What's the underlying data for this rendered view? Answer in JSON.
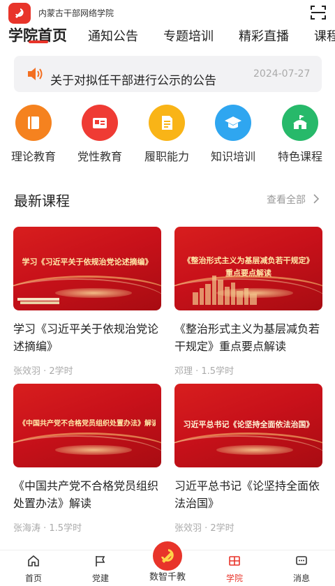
{
  "app": {
    "title": "内蒙古干部网络学院"
  },
  "tabs": [
    "学院首页",
    "通知公告",
    "专题培训",
    "精彩直播",
    "课程"
  ],
  "notice": {
    "text": "关于对拟任干部进行公示的公告",
    "date": "2024-07-27"
  },
  "categories": [
    {
      "label": "理论教育",
      "icon": "book-icon",
      "color": "#f5821f"
    },
    {
      "label": "党性教育",
      "icon": "id-card-icon",
      "color": "#ef3b34"
    },
    {
      "label": "履职能力",
      "icon": "document-icon",
      "color": "#f9b417"
    },
    {
      "label": "知识培训",
      "icon": "graduation-cap-icon",
      "color": "#2fa6f0"
    },
    {
      "label": "特色课程",
      "icon": "yurt-icon",
      "color": "#27b96a"
    }
  ],
  "latest": {
    "title": "最新课程",
    "more": "查看全部"
  },
  "courses": [
    {
      "thumb_text": "学习《习近平关于依规治党论述摘编》",
      "thumb_sub": "",
      "title": "学习《习近平关于依规治党论述摘编》",
      "meta": "张效羽 · 2学时"
    },
    {
      "thumb_text": "《整治形式主义为基层减负若干规定》",
      "thumb_sub": "重点要点解读",
      "title": "《整治形式主义为基层减负若干规定》重点要点解读",
      "meta": "邓理 · 1.5学时"
    },
    {
      "thumb_text": "《中国共产党不合格党员组织处置办法》解读",
      "thumb_sub": "",
      "title": "《中国共产党不合格党员组织处置办法》解读",
      "meta": "张海涛 · 1.5学时"
    },
    {
      "thumb_text": "习近平总书记《论坚持全面依法治国》",
      "thumb_sub": "",
      "title": "习近平总书记《论坚持全面依法治国》",
      "meta": "张效羽 · 2学时"
    }
  ],
  "nav": {
    "home": "首页",
    "party": "党建",
    "center": "数智千教",
    "academy": "学院",
    "messages": "消息"
  },
  "colors": {
    "accent": "#e8342a"
  }
}
